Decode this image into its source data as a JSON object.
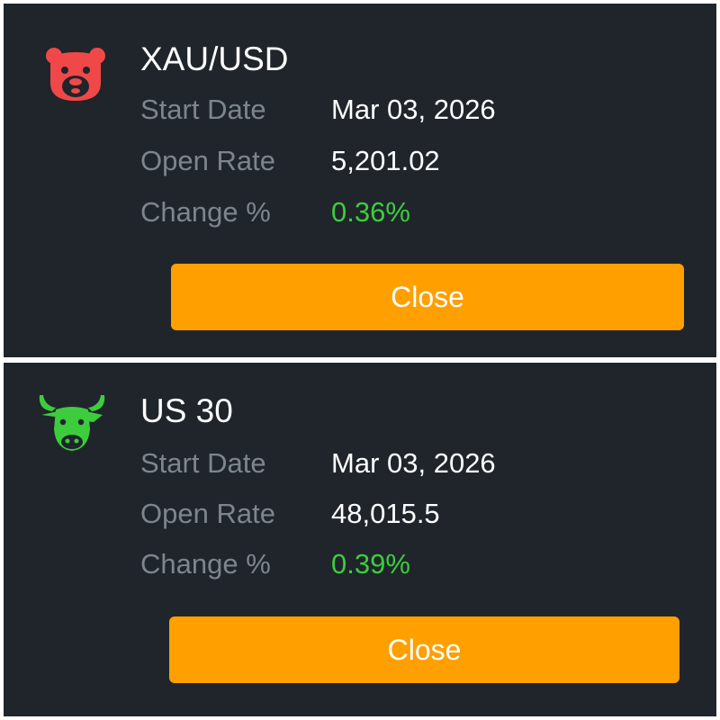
{
  "colors": {
    "background": "#1f252b",
    "label": "#7d858e",
    "value": "#ffffff",
    "positive": "#3dcc3d",
    "button": "#ff9f00",
    "bear": "#f04848",
    "bull": "#3dcc3d"
  },
  "cards": [
    {
      "icon": "bear-icon",
      "symbol": "XAU/USD",
      "start_date_label": "Start Date",
      "start_date": "Mar 03, 2026",
      "open_rate_label": "Open Rate",
      "open_rate": "5,201.02",
      "change_label": "Change %",
      "change": "0.36%",
      "close_label": "Close"
    },
    {
      "icon": "bull-icon",
      "symbol": "US 30",
      "start_date_label": "Start Date",
      "start_date": "Mar 03, 2026",
      "open_rate_label": "Open Rate",
      "open_rate": "48,015.5",
      "change_label": "Change %",
      "change": "0.39%",
      "close_label": "Close"
    }
  ]
}
